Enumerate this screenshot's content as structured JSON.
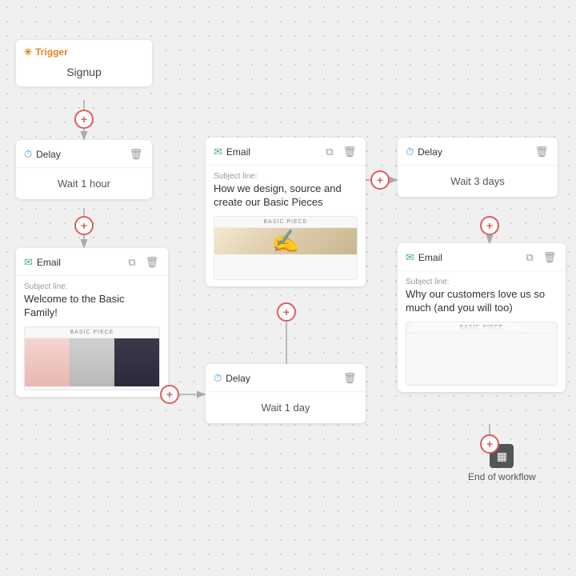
{
  "trigger": {
    "icon": "✳",
    "label": "Trigger",
    "name": "Signup"
  },
  "delay1": {
    "icon": "🕐",
    "label": "Delay",
    "wait": "Wait 1 hour"
  },
  "email1": {
    "icon": "✉",
    "label": "Email",
    "subject_prefix": "Subject line:",
    "subject": "Welcome to the Basic Family!",
    "preview_header": "BASIC PIECE"
  },
  "delay_mid": {
    "icon": "🕐",
    "label": "Delay",
    "wait": "Wait 1 day"
  },
  "email_mid": {
    "icon": "✉",
    "label": "Email",
    "subject_prefix": "Subject line:",
    "subject": "How we design, source and create our Basic Pieces",
    "preview_header": "BASIC PIECE"
  },
  "delay2": {
    "icon": "🕐",
    "label": "Delay",
    "wait": "Wait 3 days"
  },
  "email2": {
    "icon": "✉",
    "label": "Email",
    "subject_prefix": "Subject line:",
    "subject": "Why our customers love us so much (and you will too)",
    "preview_header": "BASIC PIECE"
  },
  "end": {
    "icon": "▦",
    "label": "End of workflow"
  },
  "add_btn_label": "+",
  "copy_icon": "⧉",
  "delete_icon": "🗑"
}
